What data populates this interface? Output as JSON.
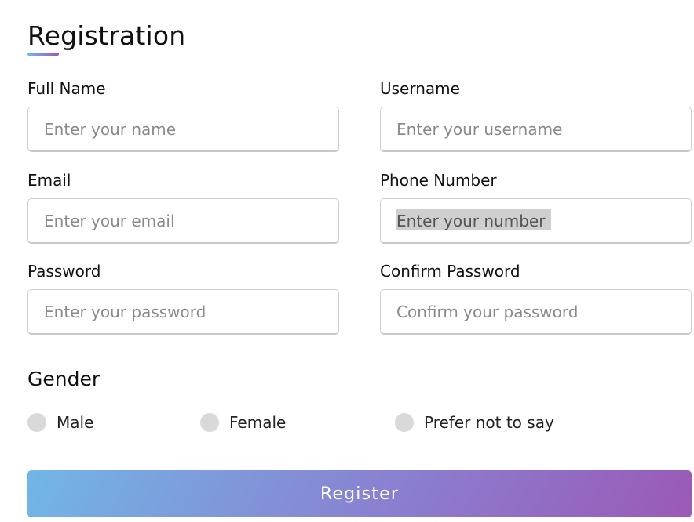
{
  "form": {
    "title": "Registration",
    "fields": {
      "full_name": {
        "label": "Full Name",
        "placeholder": "Enter your name",
        "value": ""
      },
      "username": {
        "label": "Username",
        "placeholder": "Enter your username",
        "value": ""
      },
      "email": {
        "label": "Email",
        "placeholder": "Enter your email",
        "value": ""
      },
      "phone": {
        "label": "Phone Number",
        "placeholder": "Enter your number",
        "value": "",
        "text_selected": true
      },
      "password": {
        "label": "Password",
        "placeholder": "Enter your password",
        "value": ""
      },
      "confirm_password": {
        "label": "Confirm Password",
        "placeholder": "Confirm your password",
        "value": ""
      }
    },
    "gender": {
      "title": "Gender",
      "options": [
        {
          "label": "Male",
          "selected": false
        },
        {
          "label": "Female",
          "selected": false
        },
        {
          "label": "Prefer not to say",
          "selected": false
        }
      ]
    },
    "submit_label": "Register"
  },
  "colors": {
    "gradient_start": "#71b7e6",
    "gradient_end": "#9b59b6",
    "radio_unselected": "#d9d9d9",
    "text_selection": "#cfcfcf"
  }
}
